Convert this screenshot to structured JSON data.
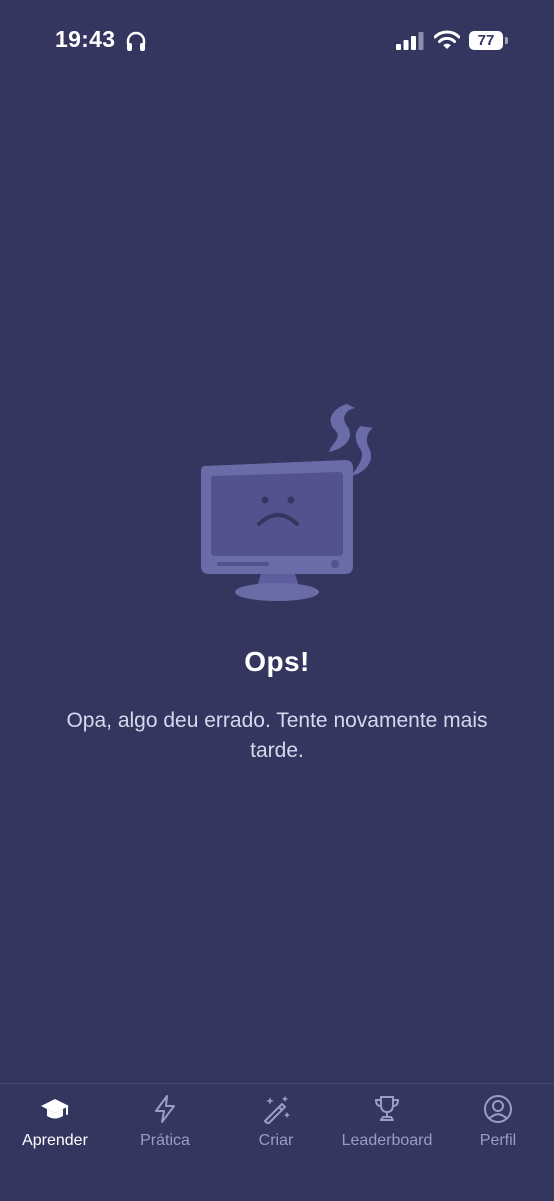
{
  "status_bar": {
    "time": "19:43",
    "battery_level": "77",
    "battery_fraction": 0.77,
    "icons": [
      "headphones-icon",
      "cellular-signal-icon",
      "wifi-icon",
      "battery-icon"
    ]
  },
  "error": {
    "illustration_icon": "broken-computer-icon",
    "title": "Ops!",
    "message": "Opa, algo deu errado. Tente novamente mais tarde."
  },
  "tab_bar": {
    "tabs": [
      {
        "label": "Aprender",
        "icon": "graduation-cap-icon",
        "active": true
      },
      {
        "label": "Prática",
        "icon": "lightning-icon",
        "active": false
      },
      {
        "label": "Criar",
        "icon": "magic-wand-icon",
        "active": false
      },
      {
        "label": "Leaderboard",
        "icon": "trophy-icon",
        "active": false
      },
      {
        "label": "Perfil",
        "icon": "user-circle-icon",
        "active": false
      }
    ]
  },
  "colors": {
    "background": "#343660",
    "illustration": "#6a6ca8",
    "active_tab": "#ffffff",
    "inactive_tab": "#9a9cc4"
  }
}
